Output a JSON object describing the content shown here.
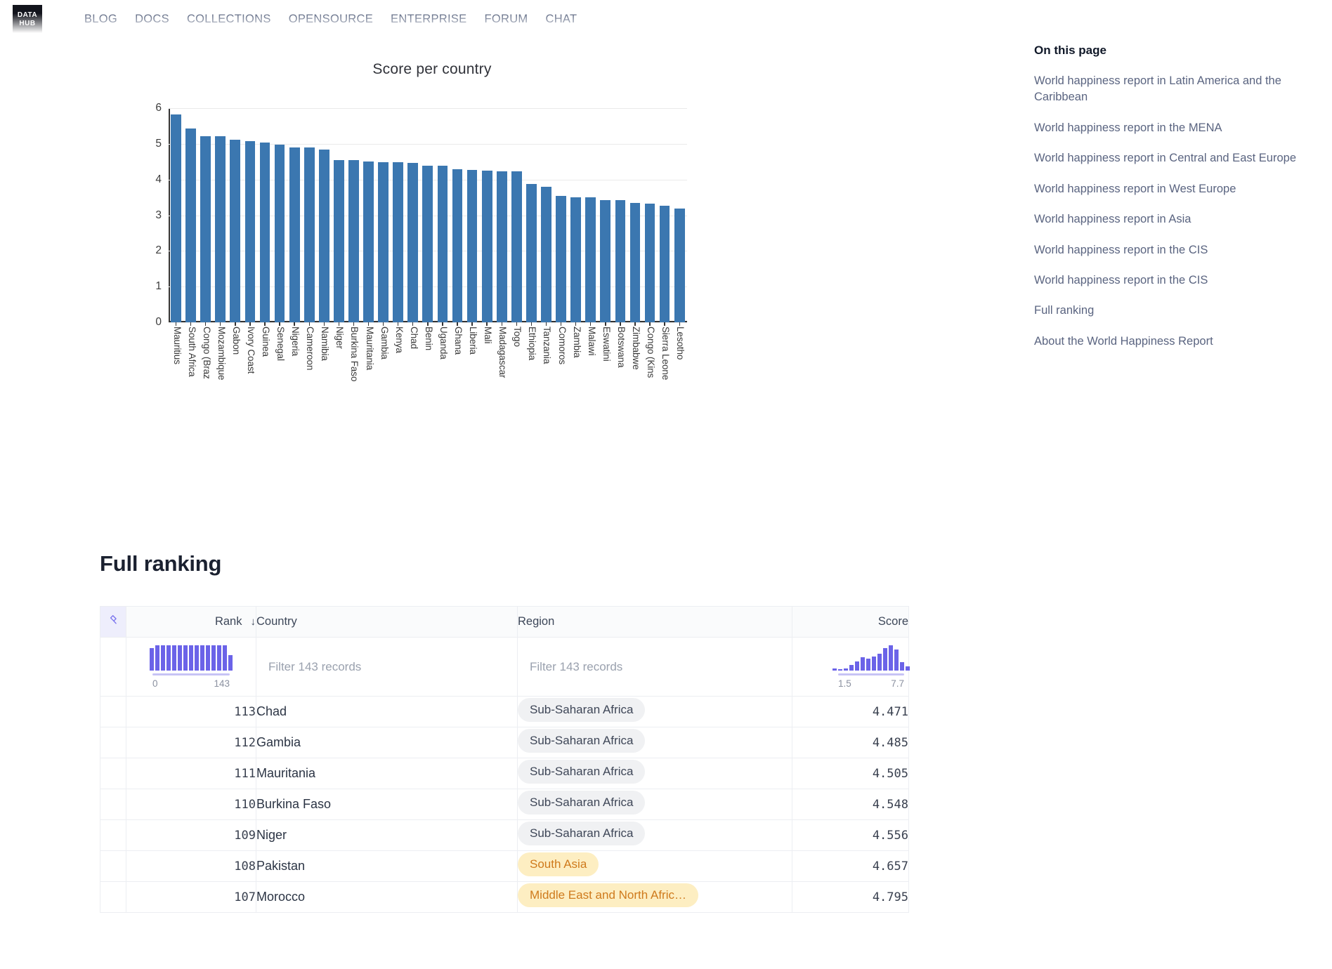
{
  "nav": {
    "logo_line1": "DATA",
    "logo_line2": "HUB",
    "links": [
      {
        "label": "BLOG"
      },
      {
        "label": "DOCS"
      },
      {
        "label": "COLLECTIONS"
      },
      {
        "label": "OPENSOURCE"
      },
      {
        "label": "ENTERPRISE"
      },
      {
        "label": "FORUM"
      },
      {
        "label": "CHAT"
      }
    ]
  },
  "toc": {
    "heading": "On this page",
    "items": [
      {
        "label": "World happiness report in Latin America and the Caribbean"
      },
      {
        "label": "World happiness report in the MENA"
      },
      {
        "label": "World happiness report in Central and East Europe"
      },
      {
        "label": "World happiness report in West Europe"
      },
      {
        "label": "World happiness report in Asia"
      },
      {
        "label": "World happiness report in the CIS"
      },
      {
        "label": "World happiness report in the CIS"
      },
      {
        "label": "Full ranking"
      },
      {
        "label": "About the World Happiness Report"
      }
    ]
  },
  "chart_data": {
    "type": "bar",
    "title": "Score per country",
    "xlabel": "",
    "ylabel": "",
    "ylim": [
      0,
      6
    ],
    "yticks": [
      0,
      1,
      2,
      3,
      4,
      5,
      6
    ],
    "grid": true,
    "bar_color": "#3b77b0",
    "categories": [
      "Mauritius",
      "South Africa",
      "Congo (Braz",
      "Mozambique",
      "Gabon",
      "Ivory Coast",
      "Guinea",
      "Senegal",
      "Nigeria",
      "Cameroon",
      "Namibia",
      "Niger",
      "Burkina Faso",
      "Mauritania",
      "Gambia",
      "Kenya",
      "Chad",
      "Benin",
      "Uganda",
      "Ghana",
      "Liberia",
      "Mali",
      "Madagascar",
      "Togo",
      "Ethiopia",
      "Tanzania",
      "Comoros",
      "Zambia",
      "Malawi",
      "Eswatini",
      "Botswana",
      "Zimbabwe",
      "Congo (Kins",
      "Sierra Leone",
      "Lesotho"
    ],
    "values": [
      5.82,
      5.42,
      5.22,
      5.22,
      5.11,
      5.08,
      5.03,
      4.98,
      4.89,
      4.89,
      4.84,
      4.55,
      4.55,
      4.51,
      4.49,
      4.48,
      4.47,
      4.39,
      4.38,
      4.29,
      4.27,
      4.24,
      4.23,
      4.22,
      3.87,
      3.79,
      3.55,
      3.51,
      3.5,
      3.43,
      3.43,
      3.34,
      3.32,
      3.27,
      3.19
    ]
  },
  "ranking": {
    "heading": "Full ranking",
    "columns": {
      "pin": "pin-icon",
      "rank": "Rank",
      "country": "Country",
      "region": "Region",
      "score": "Score"
    },
    "sort_indicator": "↓",
    "filters": {
      "rank_placeholder": "",
      "country_placeholder": "Filter 143 records",
      "region_placeholder": "Filter 143 records",
      "rank_min": "0",
      "rank_max": "143",
      "score_min": "1.5",
      "score_max": "7.7",
      "rank_histogram": [
        26,
        30,
        30,
        30,
        30,
        30,
        30,
        30,
        30,
        30,
        30,
        30,
        30,
        30,
        18
      ],
      "score_histogram": [
        3,
        1,
        3,
        8,
        13,
        19,
        17,
        20,
        24,
        32,
        36,
        30,
        12,
        6
      ]
    },
    "rows": [
      {
        "rank": "113",
        "country": "Chad",
        "region": "Sub-Saharan Africa",
        "region_style": "gray",
        "score": "4.471"
      },
      {
        "rank": "112",
        "country": "Gambia",
        "region": "Sub-Saharan Africa",
        "region_style": "gray",
        "score": "4.485"
      },
      {
        "rank": "111",
        "country": "Mauritania",
        "region": "Sub-Saharan Africa",
        "region_style": "gray",
        "score": "4.505"
      },
      {
        "rank": "110",
        "country": "Burkina Faso",
        "region": "Sub-Saharan Africa",
        "region_style": "gray",
        "score": "4.548"
      },
      {
        "rank": "109",
        "country": "Niger",
        "region": "Sub-Saharan Africa",
        "region_style": "gray",
        "score": "4.556"
      },
      {
        "rank": "108",
        "country": "Pakistan",
        "region": "South Asia",
        "region_style": "yellow",
        "score": "4.657"
      },
      {
        "rank": "107",
        "country": "Morocco",
        "region": "Middle East and North Afric…",
        "region_style": "yellow",
        "score": "4.795"
      }
    ]
  }
}
